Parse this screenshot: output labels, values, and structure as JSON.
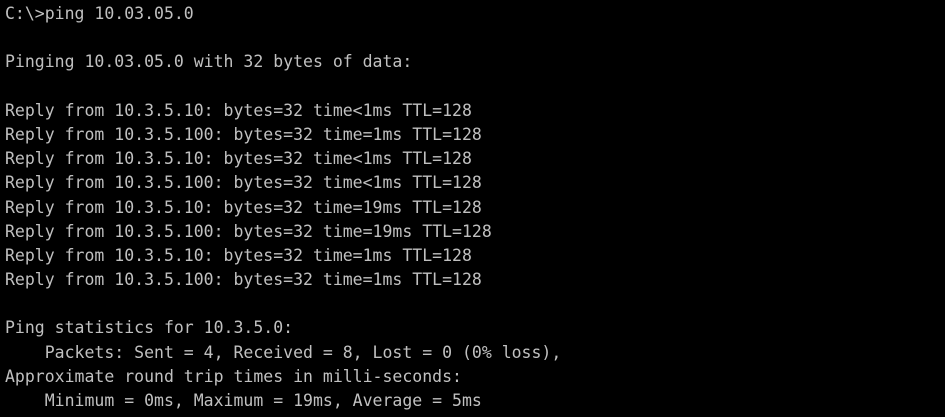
{
  "console": {
    "command_line": "C:\\>ping 10.03.05.0",
    "pinging_line": "Pinging 10.03.05.0 with 32 bytes of data:",
    "replies": [
      "Reply from 10.3.5.10: bytes=32 time<1ms TTL=128",
      "Reply from 10.3.5.100: bytes=32 time=1ms TTL=128",
      "Reply from 10.3.5.10: bytes=32 time<1ms TTL=128",
      "Reply from 10.3.5.100: bytes=32 time<1ms TTL=128",
      "Reply from 10.3.5.10: bytes=32 time=19ms TTL=128",
      "Reply from 10.3.5.100: bytes=32 time=19ms TTL=128",
      "Reply from 10.3.5.10: bytes=32 time=1ms TTL=128",
      "Reply from 10.3.5.100: bytes=32 time=1ms TTL=128"
    ],
    "stats_header": "Ping statistics for 10.3.5.0:",
    "packets_line": "    Packets: Sent = 4, Received = 8, Lost = 0 (0% loss),",
    "rtt_header": "Approximate round trip times in milli-seconds:",
    "rtt_line": "    Minimum = 0ms, Maximum = 19ms, Average = 5ms"
  },
  "colors": {
    "background": "#000000",
    "text": "#c0c0c0"
  }
}
